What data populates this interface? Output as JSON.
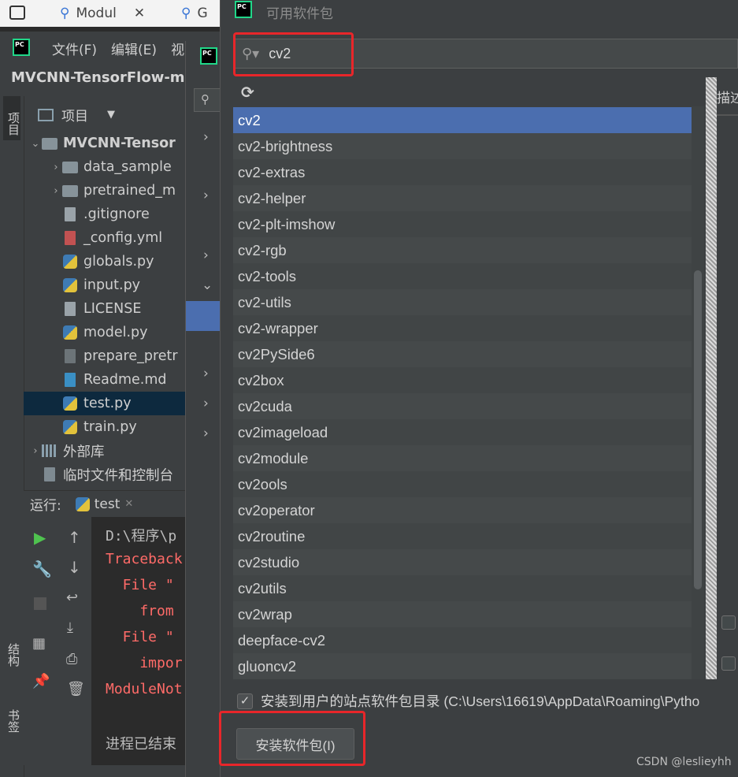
{
  "os_bar": {
    "tab1": "Modul",
    "tab2": "G"
  },
  "ide": {
    "menu": [
      "文件(F)",
      "编辑(E)",
      "视"
    ],
    "title": "MVCNN-TensorFlow-ma",
    "project_label": "项目",
    "left_tabs": {
      "project": "项目",
      "structure": "结构",
      "bookmarks": "书签"
    },
    "tree": [
      {
        "label": "MVCNN-Tensor",
        "kind": "folder",
        "arrow": "down",
        "indent": 0
      },
      {
        "label": "data_sample",
        "kind": "folder",
        "arrow": "right",
        "indent": 1
      },
      {
        "label": "pretrained_m",
        "kind": "folder",
        "arrow": "right",
        "indent": 1
      },
      {
        "label": ".gitignore",
        "kind": "file",
        "arrow": "",
        "indent": 1
      },
      {
        "label": "_config.yml",
        "kind": "yml",
        "arrow": "",
        "indent": 1
      },
      {
        "label": "globals.py",
        "kind": "py",
        "arrow": "",
        "indent": 1
      },
      {
        "label": "input.py",
        "kind": "py",
        "arrow": "",
        "indent": 1
      },
      {
        "label": "LICENSE",
        "kind": "file",
        "arrow": "",
        "indent": 1
      },
      {
        "label": "model.py",
        "kind": "py",
        "arrow": "",
        "indent": 1
      },
      {
        "label": "prepare_pretr",
        "kind": "sh",
        "arrow": "",
        "indent": 1
      },
      {
        "label": "Readme.md",
        "kind": "md",
        "arrow": "",
        "indent": 1
      },
      {
        "label": "test.py",
        "kind": "py",
        "arrow": "",
        "indent": 1,
        "selected": true
      },
      {
        "label": "train.py",
        "kind": "py",
        "arrow": "",
        "indent": 1
      },
      {
        "label": "外部库",
        "kind": "lib",
        "arrow": "right",
        "indent": 0
      },
      {
        "label": "临时文件和控制台",
        "kind": "scratch",
        "arrow": "",
        "indent": 0
      }
    ],
    "run_label": "运行:",
    "run_tab": "test",
    "console_lines": [
      {
        "text": "D:\\程序\\p",
        "color": "#bbbbbb"
      },
      {
        "text": "Traceback",
        "color": "#ff6b68"
      },
      {
        "text": "  File \"",
        "color": "#ff6b68"
      },
      {
        "text": "    from",
        "color": "#ff6b68"
      },
      {
        "text": "  File \"",
        "color": "#ff6b68"
      },
      {
        "text": "    impor",
        "color": "#ff6b68"
      },
      {
        "text": "ModuleNot",
        "color": "#ff6b68"
      },
      {
        "text": "",
        "color": "#bbbbbb"
      },
      {
        "text": "进程已结束",
        "color": "#bbbbbb"
      }
    ]
  },
  "dialog": {
    "title": "可用软件包",
    "search": {
      "value": "cv2",
      "placeholder": ""
    },
    "desc_header": "描述",
    "packages": [
      "cv2",
      "cv2-brightness",
      "cv2-extras",
      "cv2-helper",
      "cv2-plt-imshow",
      "cv2-rgb",
      "cv2-tools",
      "cv2-utils",
      "cv2-wrapper",
      "cv2PySide6",
      "cv2box",
      "cv2cuda",
      "cv2imageload",
      "cv2module",
      "cv2ools",
      "cv2operator",
      "cv2routine",
      "cv2studio",
      "cv2utils",
      "cv2wrap",
      "deepface-cv2",
      "gluoncv2"
    ],
    "selected_index": 0,
    "install_user_label": "安装到用户的站点软件包目录 (C:\\Users\\16619\\AppData\\Roaming\\Pytho",
    "install_user_checked": true,
    "install_button": "安装软件包(I)"
  },
  "watermark": "CSDN @leslieyhh",
  "colors": {
    "selection": "#4b6eaf",
    "highlight_box": "#e8262a",
    "error_text": "#ff6b68"
  }
}
